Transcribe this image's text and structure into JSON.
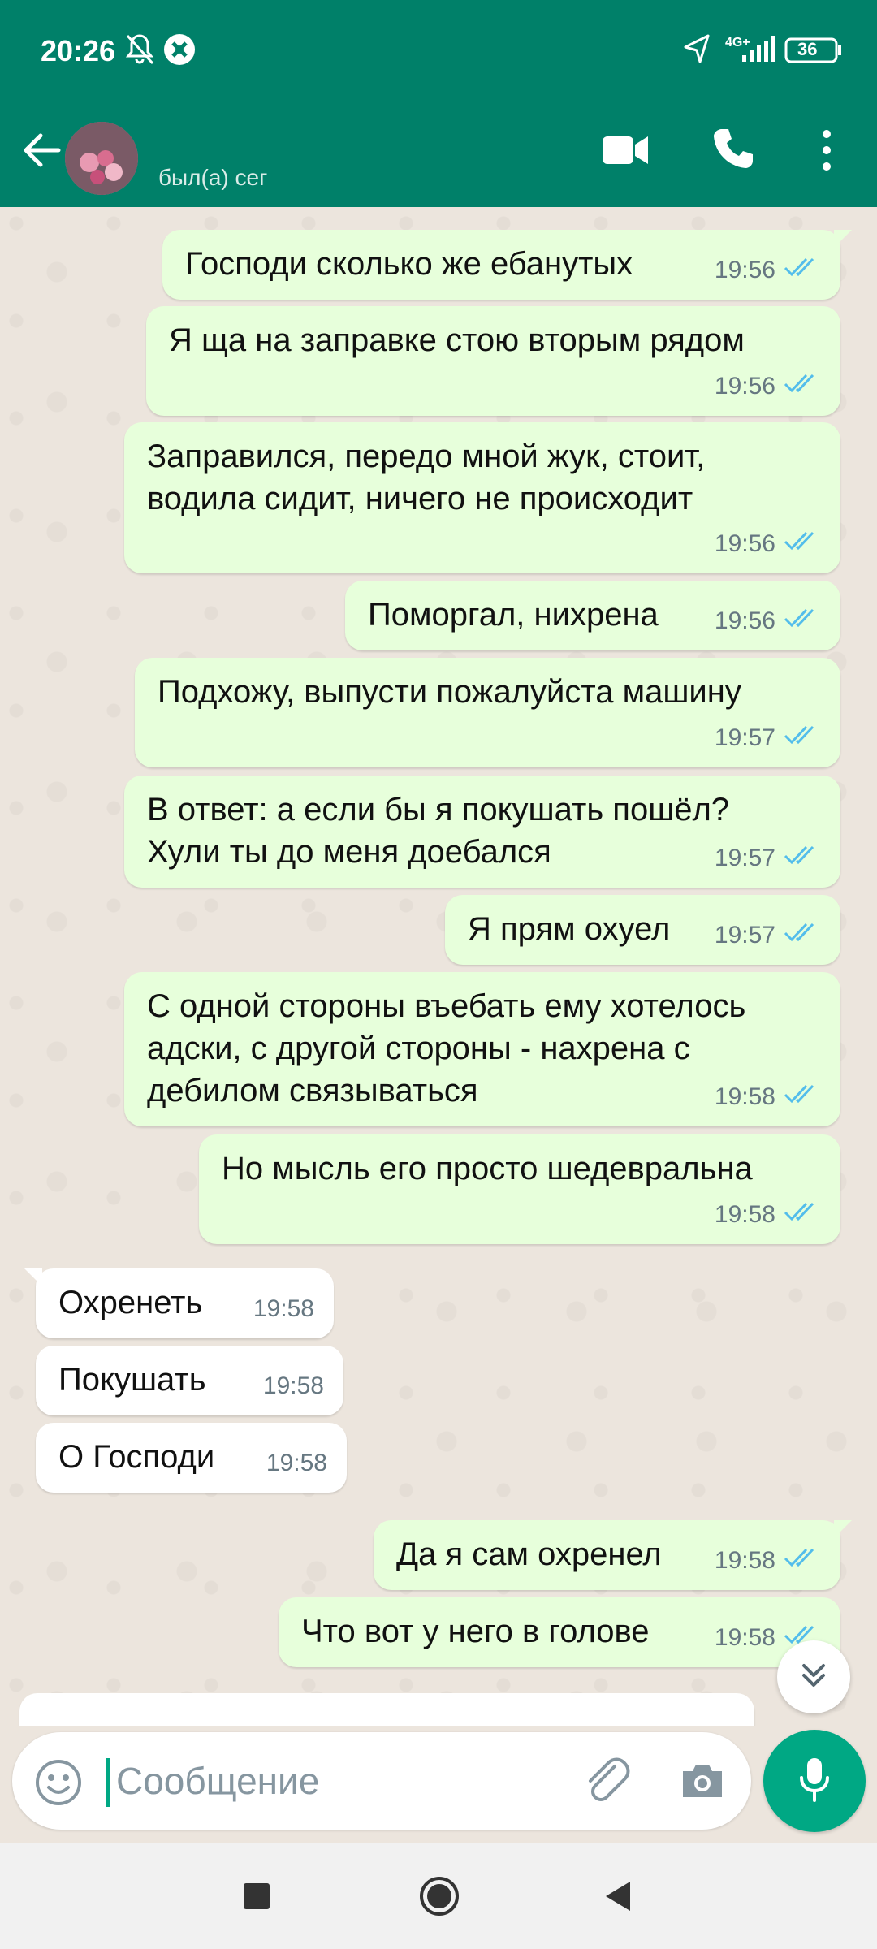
{
  "status_bar": {
    "time": "20:26",
    "network": "4G+",
    "battery": "36"
  },
  "header": {
    "title": "",
    "subtitle": "был(а) сег"
  },
  "messages": [
    {
      "dir": "out",
      "text": "Господи сколько же ебанутых",
      "time": "19:56",
      "status": "read"
    },
    {
      "dir": "out",
      "text": "Я ща на заправке стою вторым рядом",
      "time": "19:56",
      "status": "read"
    },
    {
      "dir": "out",
      "text": "Заправился, передо мной жук, стоит,\nводила сидит, ничего не происходит",
      "time": "19:56",
      "status": "read"
    },
    {
      "dir": "out",
      "text": "Поморгал, нихрена",
      "time": "19:56",
      "status": "read"
    },
    {
      "dir": "out",
      "text": "Подхожу, выпусти пожалуйста машину",
      "time": "19:57",
      "status": "read"
    },
    {
      "dir": "out",
      "text": "В ответ: а если бы я покушать пошёл?\nХули ты до меня доебался",
      "time": "19:57",
      "status": "read"
    },
    {
      "dir": "out",
      "text": "Я прям охуел",
      "time": "19:57",
      "status": "read"
    },
    {
      "dir": "out",
      "text": "С одной стороны въебать ему хотелось\nадски, с другой стороны - нахрена с\nдебилом связываться",
      "time": "19:58",
      "status": "read"
    },
    {
      "dir": "out",
      "text": "Но мысль его просто шедевральна",
      "time": "19:58",
      "status": "read"
    },
    {
      "dir": "in",
      "text": "Охренеть",
      "time": "19:58"
    },
    {
      "dir": "in",
      "text": "Покушать",
      "time": "19:58"
    },
    {
      "dir": "in",
      "text": "О Господи",
      "time": "19:58"
    },
    {
      "dir": "out",
      "text": "Да я сам охренел",
      "time": "19:58",
      "status": "read"
    },
    {
      "dir": "out",
      "text": "Что вот у него в голове",
      "time": "19:58",
      "status": "read"
    }
  ],
  "composer": {
    "placeholder": "Сообщение"
  },
  "colors": {
    "header": "#008069",
    "outgoing_bubble": "#e7ffdb",
    "incoming_bubble": "#ffffff",
    "read_ticks": "#53bdeb",
    "accent": "#00a884"
  },
  "icons": {
    "back": "arrow-left-icon",
    "video": "video-call-icon",
    "call": "phone-icon",
    "menu": "more-vert-icon",
    "emoji": "emoji-icon",
    "attach": "paperclip-icon",
    "camera": "camera-icon",
    "mic": "mic-icon",
    "scroll": "double-chevron-down-icon"
  }
}
